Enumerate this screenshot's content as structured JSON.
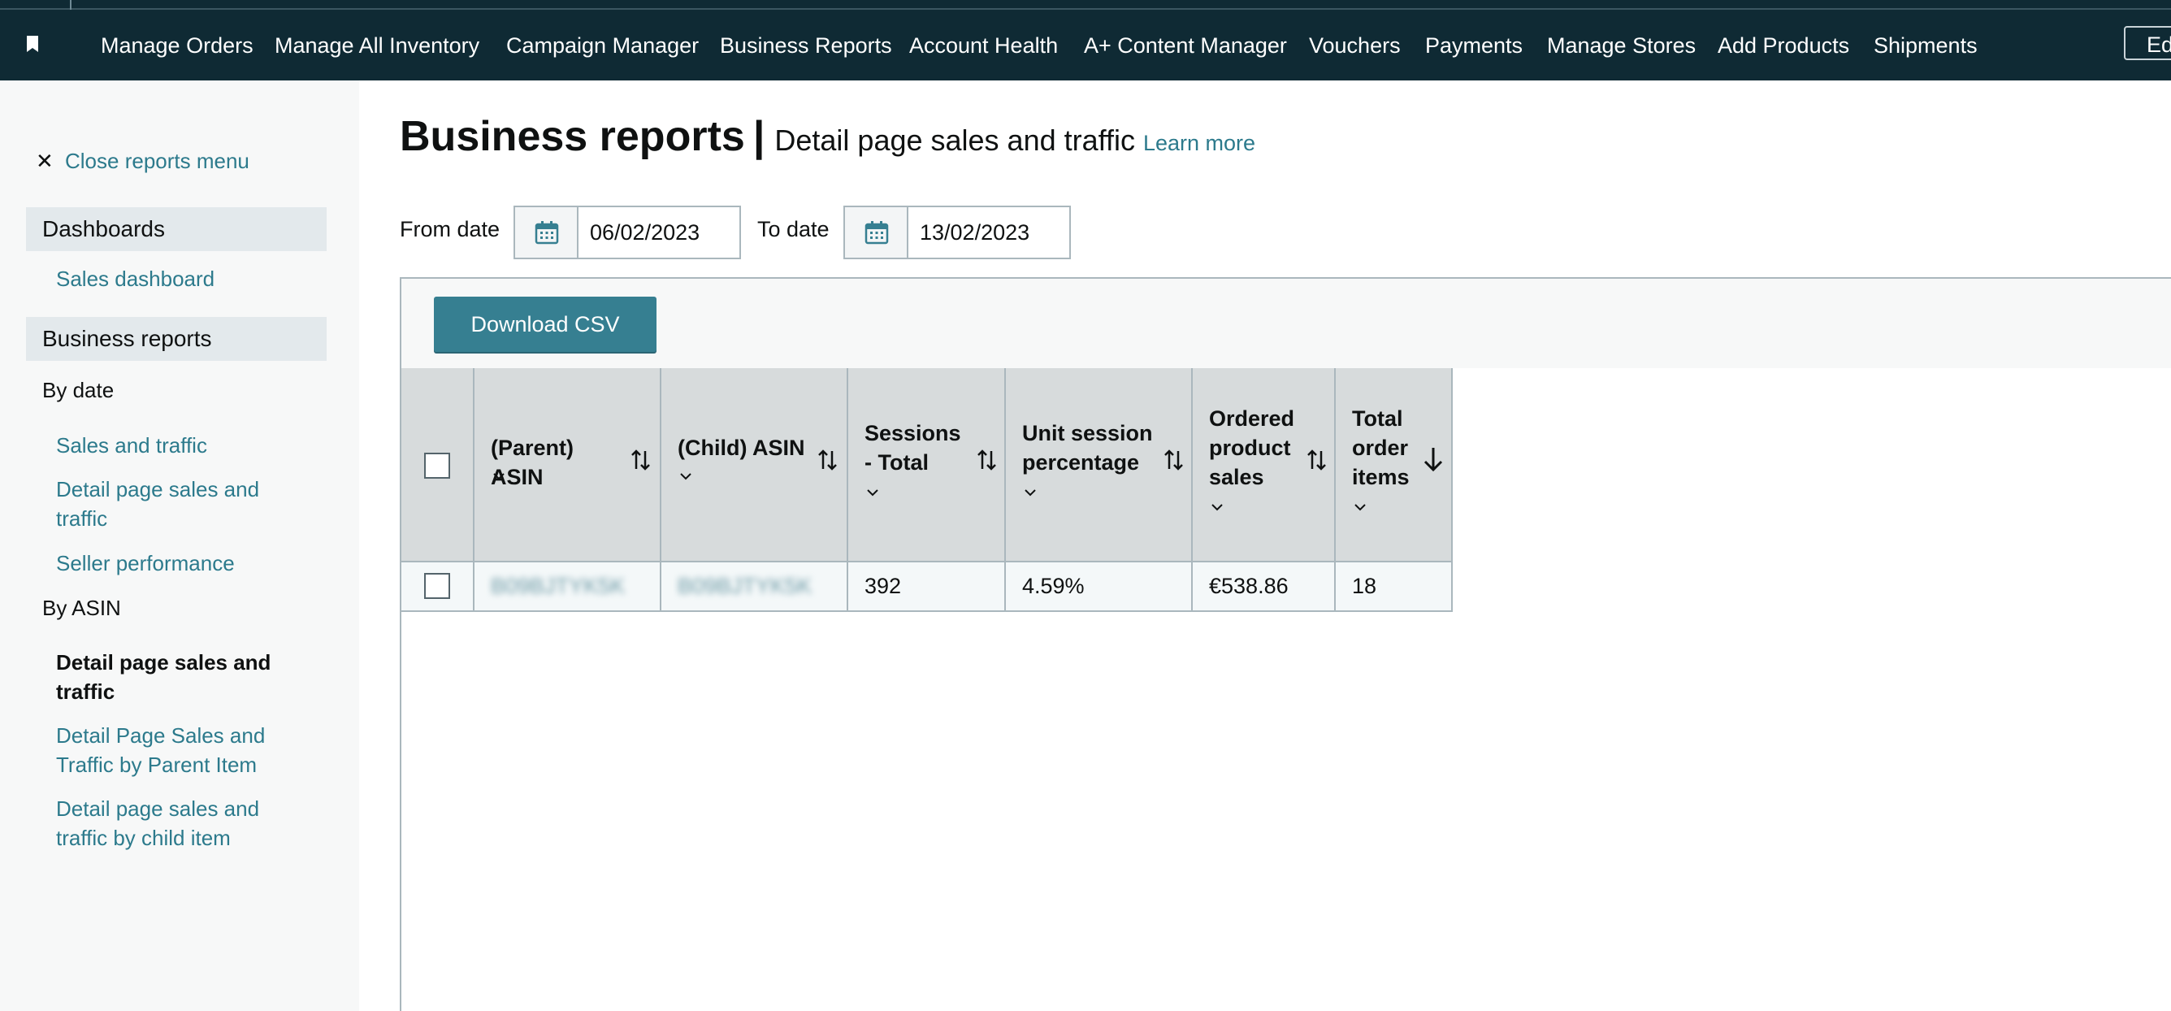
{
  "nav": {
    "items": [
      "Manage Orders",
      "Manage All Inventory",
      "Campaign Manager",
      "Business Reports",
      "Account Health",
      "A+ Content Manager",
      "Vouchers",
      "Payments",
      "Manage Stores",
      "Add Products",
      "Shipments"
    ],
    "edit_label": "Ed"
  },
  "sidebar": {
    "close_label": "Close reports menu",
    "dashboards_heading": "Dashboards",
    "sales_dashboard": "Sales dashboard",
    "business_reports_heading": "Business reports",
    "by_date_label": "By date",
    "by_date_links": [
      "Sales and traffic",
      "Detail page sales and traffic",
      "Seller performance"
    ],
    "by_asin_label": "By ASIN",
    "by_asin_active": "Detail page sales and traffic",
    "by_asin_links": [
      "Detail Page Sales and Traffic by Parent Item",
      "Detail page sales and traffic by child item"
    ]
  },
  "header": {
    "title": "Business reports",
    "separator": "|",
    "subtitle": "Detail page sales and traffic",
    "learn_more": "Learn more"
  },
  "dates": {
    "from_label": "From date",
    "from_value": "06/02/2023",
    "to_label": "To date",
    "to_value": "13/02/2023"
  },
  "toolbar": {
    "download_label": "Download CSV"
  },
  "table": {
    "columns": [
      "(Parent) ASIN",
      "(Child) ASIN",
      "Sessions - Total",
      "Unit session percentage",
      "Ordered product sales",
      "Total order items"
    ],
    "rows": [
      {
        "parent_asin": "B09BJTYK5K",
        "child_asin": "B09BJTYK5K",
        "sessions_total": "392",
        "unit_session_percentage": "4.59%",
        "ordered_product_sales": "€538.86",
        "total_order_items": "18"
      }
    ]
  },
  "colors": {
    "nav_bg": "#0f2a34",
    "link": "#2c7a8c",
    "button": "#367f91",
    "header_cell": "#d7dbdc"
  }
}
